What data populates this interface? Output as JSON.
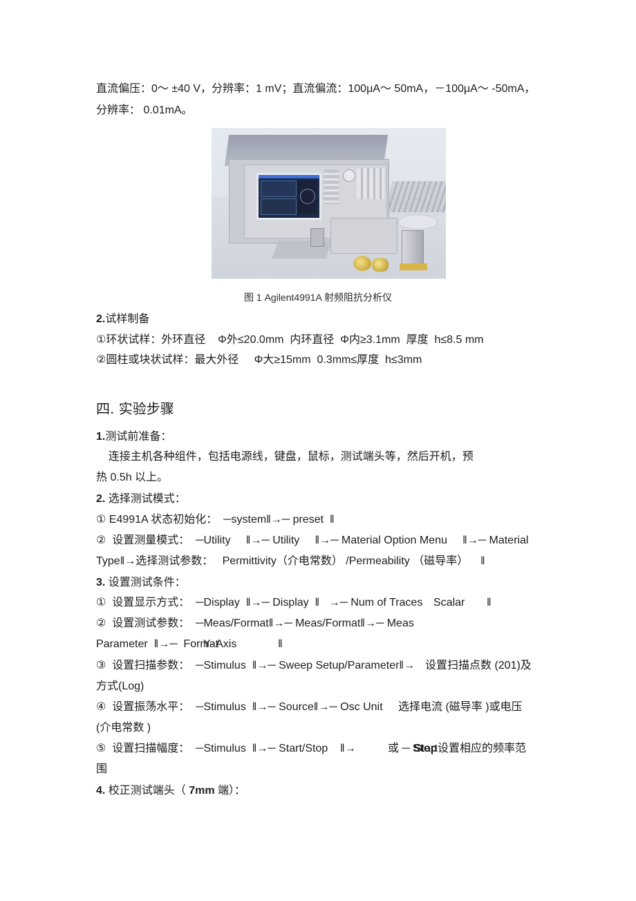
{
  "document": {
    "intro": {
      "line1": "直流偏压：0～ ±40 V，分辨率：1 mV；直流偏流：100μA～ 50mA，－100μA～ -50mA，",
      "line2": "分辨率： 0.01mA。"
    },
    "figure": {
      "image_alt": "Agilent 4991A RF impedance analyzer with test fixtures, keyboard and mouse",
      "caption": "图 1   Agilent4991A  射频阻抗分析仪"
    },
    "section_2_prep": {
      "title_num": "2.",
      "title": "试样制备",
      "item1": "①环状试样：外环直径    Φ外≤20.0mm  内环直径  Φ内≥3.1mm  厚度  h≤8.5 mm",
      "item2": "②圆柱或块状试样：最大外径     Φ大≥15mm  0.3mm≤厚度  h≤3mm"
    },
    "section_4": {
      "heading": "四. 实验步骤",
      "step1": {
        "num": "1.",
        "title": "测试前准备：",
        "text1": "    连接主机各种组件，包括电源线，键盘，鼠标，测试端头等，然后开机，预",
        "text2": "热 0.5h 以上。"
      },
      "step2": {
        "num": "2.",
        "title": " 选择测试模式：",
        "item1": "① E4991A 状态初始化：  ─system‖→─ preset  ‖",
        "item2": "②  设置测量模式：  ─Utility     ‖→─ Utility     ‖→─ Material Option Menu     ‖→─ Material",
        "item2b": "Type‖→选择测试参数：   Permittivity（介电常数） /Permeability （磁导率）    ‖"
      },
      "step3": {
        "num": "3.",
        "title": " 设置测试条件：",
        "item1": "①  设置显示方式：  ─Display  ‖→─ Display  ‖   →─ Num of Traces",
        "item1_overlap": "Scalar",
        "item1_end": "‖",
        "item2": "②  设置测试参数：  ─Meas/Format‖→─ Meas/Format‖→─ Meas",
        "item2b": "Parameter  ‖→─  Format",
        "item2b_overlap": "Y- Axis",
        "item2b_end": "‖",
        "item3": "③  设置扫描参数：  ─Stimulus  ‖→─ Sweep Setup/Parameter‖→",
        "item3_overlap": "设置扫描点数 (201)及",
        "item3b": "方式(Log)",
        "item4": "④  设置振荡水平：  ─Stimulus  ‖→─ Source‖→─ Osc Unit",
        "item4_overlap": "选择电流 (磁导率 )或电压",
        "item4b": "(介电常数 )",
        "item5": "⑤  设置扫描幅度：  ─Stimulus  ‖→─ Start/Stop    ‖→",
        "item5_overlap_a": "或 ─",
        "item5_overlap_b": "Stop",
        "item5_overlap_b2": "Start",
        "item5_overlap_c": "设置相应的频率范",
        "item5b": "围"
      },
      "step4": {
        "num": "4.",
        "title": " 校正测试端头（ ",
        "bold": "7mm",
        "title_end": " 端）："
      }
    }
  }
}
